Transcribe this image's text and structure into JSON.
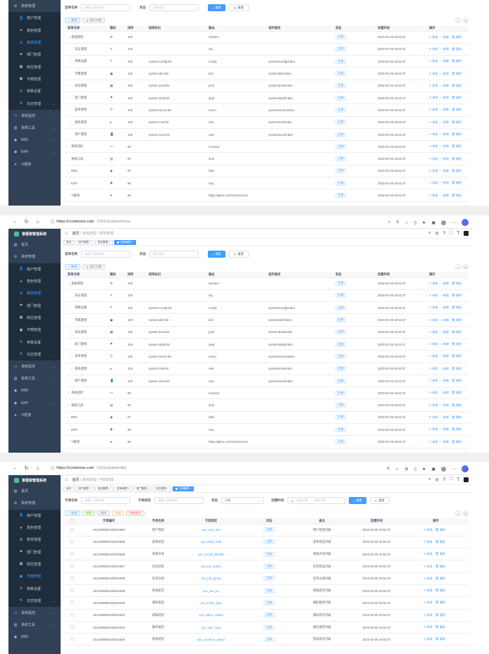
{
  "p1": {
    "form": {
      "name_label": "菜单名称",
      "name_ph": "请输入菜单名称",
      "status_label": "状态",
      "status_ph": "菜单状态",
      "search": "搜索",
      "reset": "重置"
    },
    "actions": {
      "add": "新增",
      "expand": "展开/折叠"
    }
  },
  "browser": {
    "url2_host": "https://ccnetcore.com",
    "url2_path": ":1101/system/menu",
    "url3_host": "https://ccnetcore.com",
    "url3_path": ":1101/system/dict"
  },
  "app": {
    "title": "意框架管理系统",
    "nav_home": "首页",
    "nav_sys": "系统管理",
    "nav_menu": "菜单管理",
    "nav_dict": "字典管理"
  },
  "side2": [
    {
      "label": "首页",
      "icon": "▤",
      "sub": false,
      "active": false,
      "arrow": ""
    },
    {
      "label": "系统管理",
      "icon": "⚙",
      "sub": false,
      "active": false,
      "arrow": "⌃"
    },
    {
      "label": "用户管理",
      "icon": "👤",
      "sub": true,
      "active": false,
      "arrow": ""
    },
    {
      "label": "角色管理",
      "icon": "●",
      "sub": true,
      "active": false,
      "arrow": ""
    },
    {
      "label": "菜单管理",
      "icon": "☰",
      "sub": true,
      "active": true,
      "arrow": ""
    },
    {
      "label": "部门管理",
      "icon": "⚑",
      "sub": true,
      "active": false,
      "arrow": ""
    },
    {
      "label": "岗位管理",
      "icon": "▦",
      "sub": true,
      "active": false,
      "arrow": ""
    },
    {
      "label": "字典管理",
      "icon": "▣",
      "sub": true,
      "active": false,
      "arrow": ""
    },
    {
      "label": "参数设置",
      "icon": "✎",
      "sub": true,
      "active": false,
      "arrow": ""
    },
    {
      "label": "日志管理",
      "icon": "✎",
      "sub": true,
      "active": false,
      "arrow": "⌄"
    },
    {
      "label": "系统监控",
      "icon": "▭",
      "sub": false,
      "active": false,
      "arrow": "⌄"
    },
    {
      "label": "系统工具",
      "icon": "▥",
      "sub": false,
      "active": false,
      "arrow": "⌄"
    },
    {
      "label": "BBS",
      "icon": "◉",
      "sub": false,
      "active": false,
      "arrow": "⌄"
    },
    {
      "label": "ERP",
      "icon": "◉",
      "sub": false,
      "active": false,
      "arrow": "⌄"
    },
    {
      "label": "Yi框架",
      "icon": "➤",
      "sub": false,
      "active": false,
      "arrow": ""
    }
  ],
  "side3": [
    {
      "label": "首页",
      "icon": "▤",
      "sub": false,
      "active": false,
      "arrow": ""
    },
    {
      "label": "系统管理",
      "icon": "⚙",
      "sub": false,
      "active": false,
      "arrow": "⌃"
    },
    {
      "label": "用户管理",
      "icon": "👤",
      "sub": true,
      "active": false,
      "arrow": ""
    },
    {
      "label": "角色管理",
      "icon": "●",
      "sub": true,
      "active": false,
      "arrow": ""
    },
    {
      "label": "菜单管理",
      "icon": "☰",
      "sub": true,
      "active": false,
      "arrow": ""
    },
    {
      "label": "部门管理",
      "icon": "⚑",
      "sub": true,
      "active": false,
      "arrow": ""
    },
    {
      "label": "岗位管理",
      "icon": "▦",
      "sub": true,
      "active": false,
      "arrow": ""
    },
    {
      "label": "字典管理",
      "icon": "▣",
      "sub": true,
      "active": true,
      "arrow": ""
    },
    {
      "label": "参数设置",
      "icon": "✎",
      "sub": true,
      "active": false,
      "arrow": ""
    },
    {
      "label": "日志管理",
      "icon": "✎",
      "sub": true,
      "active": false,
      "arrow": "⌄"
    },
    {
      "label": "系统监控",
      "icon": "▭",
      "sub": false,
      "active": false,
      "arrow": "⌄"
    },
    {
      "label": "系统工具",
      "icon": "▥",
      "sub": false,
      "active": false,
      "arrow": "⌄"
    },
    {
      "label": "BBS",
      "icon": "◉",
      "sub": false,
      "active": false,
      "arrow": "⌄"
    }
  ],
  "tags2": [
    {
      "label": "首页",
      "on": false
    },
    {
      "label": "用户管理 ×",
      "on": false
    },
    {
      "label": "角色管理 ×",
      "on": false
    },
    {
      "label": "菜单管理 ×",
      "on": true
    }
  ],
  "tags3": [
    {
      "label": "首页",
      "on": false
    },
    {
      "label": "用户管理 ×",
      "on": false
    },
    {
      "label": "角色管理 ×",
      "on": false
    },
    {
      "label": "菜单管理 ×",
      "on": false
    },
    {
      "label": "部门管理 ×",
      "on": false
    },
    {
      "label": "岗位管理 ×",
      "on": false
    },
    {
      "label": "字典管理 ×",
      "on": true
    }
  ],
  "menu_table": {
    "headers": [
      "菜单名称",
      "图标",
      "排序",
      "权限标识",
      "路由",
      "组件路径",
      "状态",
      "创建时间",
      "操作"
    ],
    "edit": "修改",
    "add": "新增",
    "del": "删除",
    "rows": [
      {
        "name": "系统管理",
        "tw": "⌄",
        "indent": 0,
        "icon": "⚙",
        "sort": "100",
        "perm": "",
        "route": "/system",
        "comp": "",
        "status": "正常",
        "time": "2023-03-29 16:52:37"
      },
      {
        "name": "日志管理",
        "tw": "›",
        "indent": 1,
        "icon": "✎",
        "sort": "100",
        "perm": "",
        "route": "log",
        "comp": "",
        "status": "正常",
        "time": "2023-03-29 16:52:37"
      },
      {
        "name": "参数设置",
        "tw": "›",
        "indent": 1,
        "icon": "✎",
        "sort": "100",
        "perm": "system:config:list",
        "route": "config",
        "comp": "system/config/index",
        "status": "正常",
        "time": "2023-03-29 16:52:37"
      },
      {
        "name": "字典管理",
        "tw": "›",
        "indent": 1,
        "icon": "▣",
        "sort": "100",
        "perm": "system:dict:list",
        "route": "dict",
        "comp": "system/dict/index",
        "status": "正常",
        "time": "2023-03-29 16:52:37"
      },
      {
        "name": "岗位管理",
        "tw": "›",
        "indent": 1,
        "icon": "▦",
        "sort": "100",
        "perm": "system:post:list",
        "route": "post",
        "comp": "system/post/index",
        "status": "正常",
        "time": "2023-03-29 16:52:37"
      },
      {
        "name": "部门管理",
        "tw": "›",
        "indent": 1,
        "icon": "⚑",
        "sort": "100",
        "perm": "system:dept:list",
        "route": "dept",
        "comp": "system/dept/index",
        "status": "正常",
        "time": "2023-03-29 16:52:37"
      },
      {
        "name": "菜单管理",
        "tw": "›",
        "indent": 1,
        "icon": "☰",
        "sort": "100",
        "perm": "system:menu:list",
        "route": "menu",
        "comp": "system/menu/index",
        "status": "正常",
        "time": "2023-03-29 16:52:37"
      },
      {
        "name": "角色管理",
        "tw": "›",
        "indent": 1,
        "icon": "●",
        "sort": "100",
        "perm": "system:role:list",
        "route": "role",
        "comp": "system/role/index",
        "status": "正常",
        "time": "2023-03-29 16:52:37"
      },
      {
        "name": "用户管理",
        "tw": "›",
        "indent": 1,
        "icon": "👤",
        "sort": "100",
        "perm": "system:user:list",
        "route": "user",
        "comp": "system/user/index",
        "status": "正常",
        "time": "2023-03-29 16:52:37"
      },
      {
        "name": "系统监控",
        "tw": "›",
        "indent": 0,
        "icon": "▭",
        "sort": "99",
        "perm": "",
        "route": "/monitor",
        "comp": "",
        "status": "正常",
        "time": "2023-03-29 16:52:37"
      },
      {
        "name": "系统工具",
        "tw": "›",
        "indent": 0,
        "icon": "▥",
        "sort": "98",
        "perm": "",
        "route": "/tool",
        "comp": "",
        "status": "正常",
        "time": "2023-03-29 16:52:37"
      },
      {
        "name": "BBS",
        "tw": "›",
        "indent": 0,
        "icon": "◉",
        "sort": "97",
        "perm": "",
        "route": "/bbs",
        "comp": "",
        "status": "正常",
        "time": "2023-03-29 16:52:37"
      },
      {
        "name": "ERP",
        "tw": "›",
        "indent": 0,
        "icon": "◉",
        "sort": "96",
        "perm": "",
        "route": "/erp",
        "comp": "",
        "status": "正常",
        "time": "2023-03-29 16:52:37"
      },
      {
        "name": "Yi框架",
        "tw": "",
        "indent": 0,
        "icon": "➤",
        "sort": "90",
        "perm": "",
        "route": "https://gitee.com/ccnetcore/yi",
        "comp": "",
        "status": "正常",
        "time": "2023-03-29 16:52:37"
      }
    ]
  },
  "p3": {
    "form": {
      "name_label": "字典名称",
      "name_ph": "请输入字典名称",
      "type_label": "字典类型",
      "type_ph": "请输入字典类型",
      "status_label": "状态",
      "status_val": "正常",
      "time_label": "创建时间",
      "time_start": "开始日期",
      "time_sep": "-",
      "time_end": "结束日期",
      "search": "搜索",
      "reset": "重置"
    },
    "actions": {
      "add": "新增",
      "edit": "修改",
      "del": "删除",
      "export": "导出",
      "refresh": "刷新缓存"
    }
  },
  "dict_table": {
    "headers": [
      "字典编号",
      "字典名称",
      "字典类型",
      "状态",
      "备注",
      "创建时间",
      "操作"
    ],
    "edit": "修改",
    "del": "删除",
    "rows": [
      {
        "id": "1641008590245031584",
        "name": "用户性别",
        "type": "sys_user_sex",
        "status": "正常",
        "remark": "用户性别列表",
        "time": "2023-03-29 16:52:37"
      },
      {
        "id": "1641008590245031585",
        "name": "菜单状态",
        "type": "sys_show_hide",
        "status": "正常",
        "remark": "菜单状态列表",
        "time": "2023-03-29 16:52:37"
      },
      {
        "id": "1641008590245031586",
        "name": "系统开关",
        "type": "sys_normal_disable",
        "status": "正常",
        "remark": "系统开关列表",
        "time": "2023-03-29 16:52:37"
      },
      {
        "id": "1641008590245031587",
        "name": "任务状态",
        "type": "sys_job_status",
        "status": "正常",
        "remark": "任务状态列表",
        "time": "2023-03-29 16:52:37"
      },
      {
        "id": "1641008590245031588",
        "name": "任务分组",
        "type": "sys_job_group",
        "status": "正常",
        "remark": "任务分组列表",
        "time": "2023-03-29 16:52:37"
      },
      {
        "id": "1641008590245031589",
        "name": "系统是否",
        "type": "sys_yes_no",
        "status": "正常",
        "remark": "系统是否列表",
        "time": "2023-03-29 16:52:37"
      },
      {
        "id": "1641008590245031590",
        "name": "通知类型",
        "type": "sys_notice_type",
        "status": "正常",
        "remark": "通知类型列表",
        "time": "2023-03-29 16:52:37"
      },
      {
        "id": "1641008590245031591",
        "name": "通知状态",
        "type": "sys_notice_status",
        "status": "正常",
        "remark": "通知状态列表",
        "time": "2023-03-29 16:52:37"
      },
      {
        "id": "1641008590245031592",
        "name": "操作类型",
        "type": "sys_oper_type",
        "status": "正常",
        "remark": "操作类型列表",
        "time": "2023-03-29 16:52:37"
      },
      {
        "id": "1641008590245031593",
        "name": "系统状态",
        "type": "sys_common_status",
        "status": "正常",
        "remark": "登录状态列表",
        "time": "2023-03-29 16:52:37"
      }
    ]
  }
}
